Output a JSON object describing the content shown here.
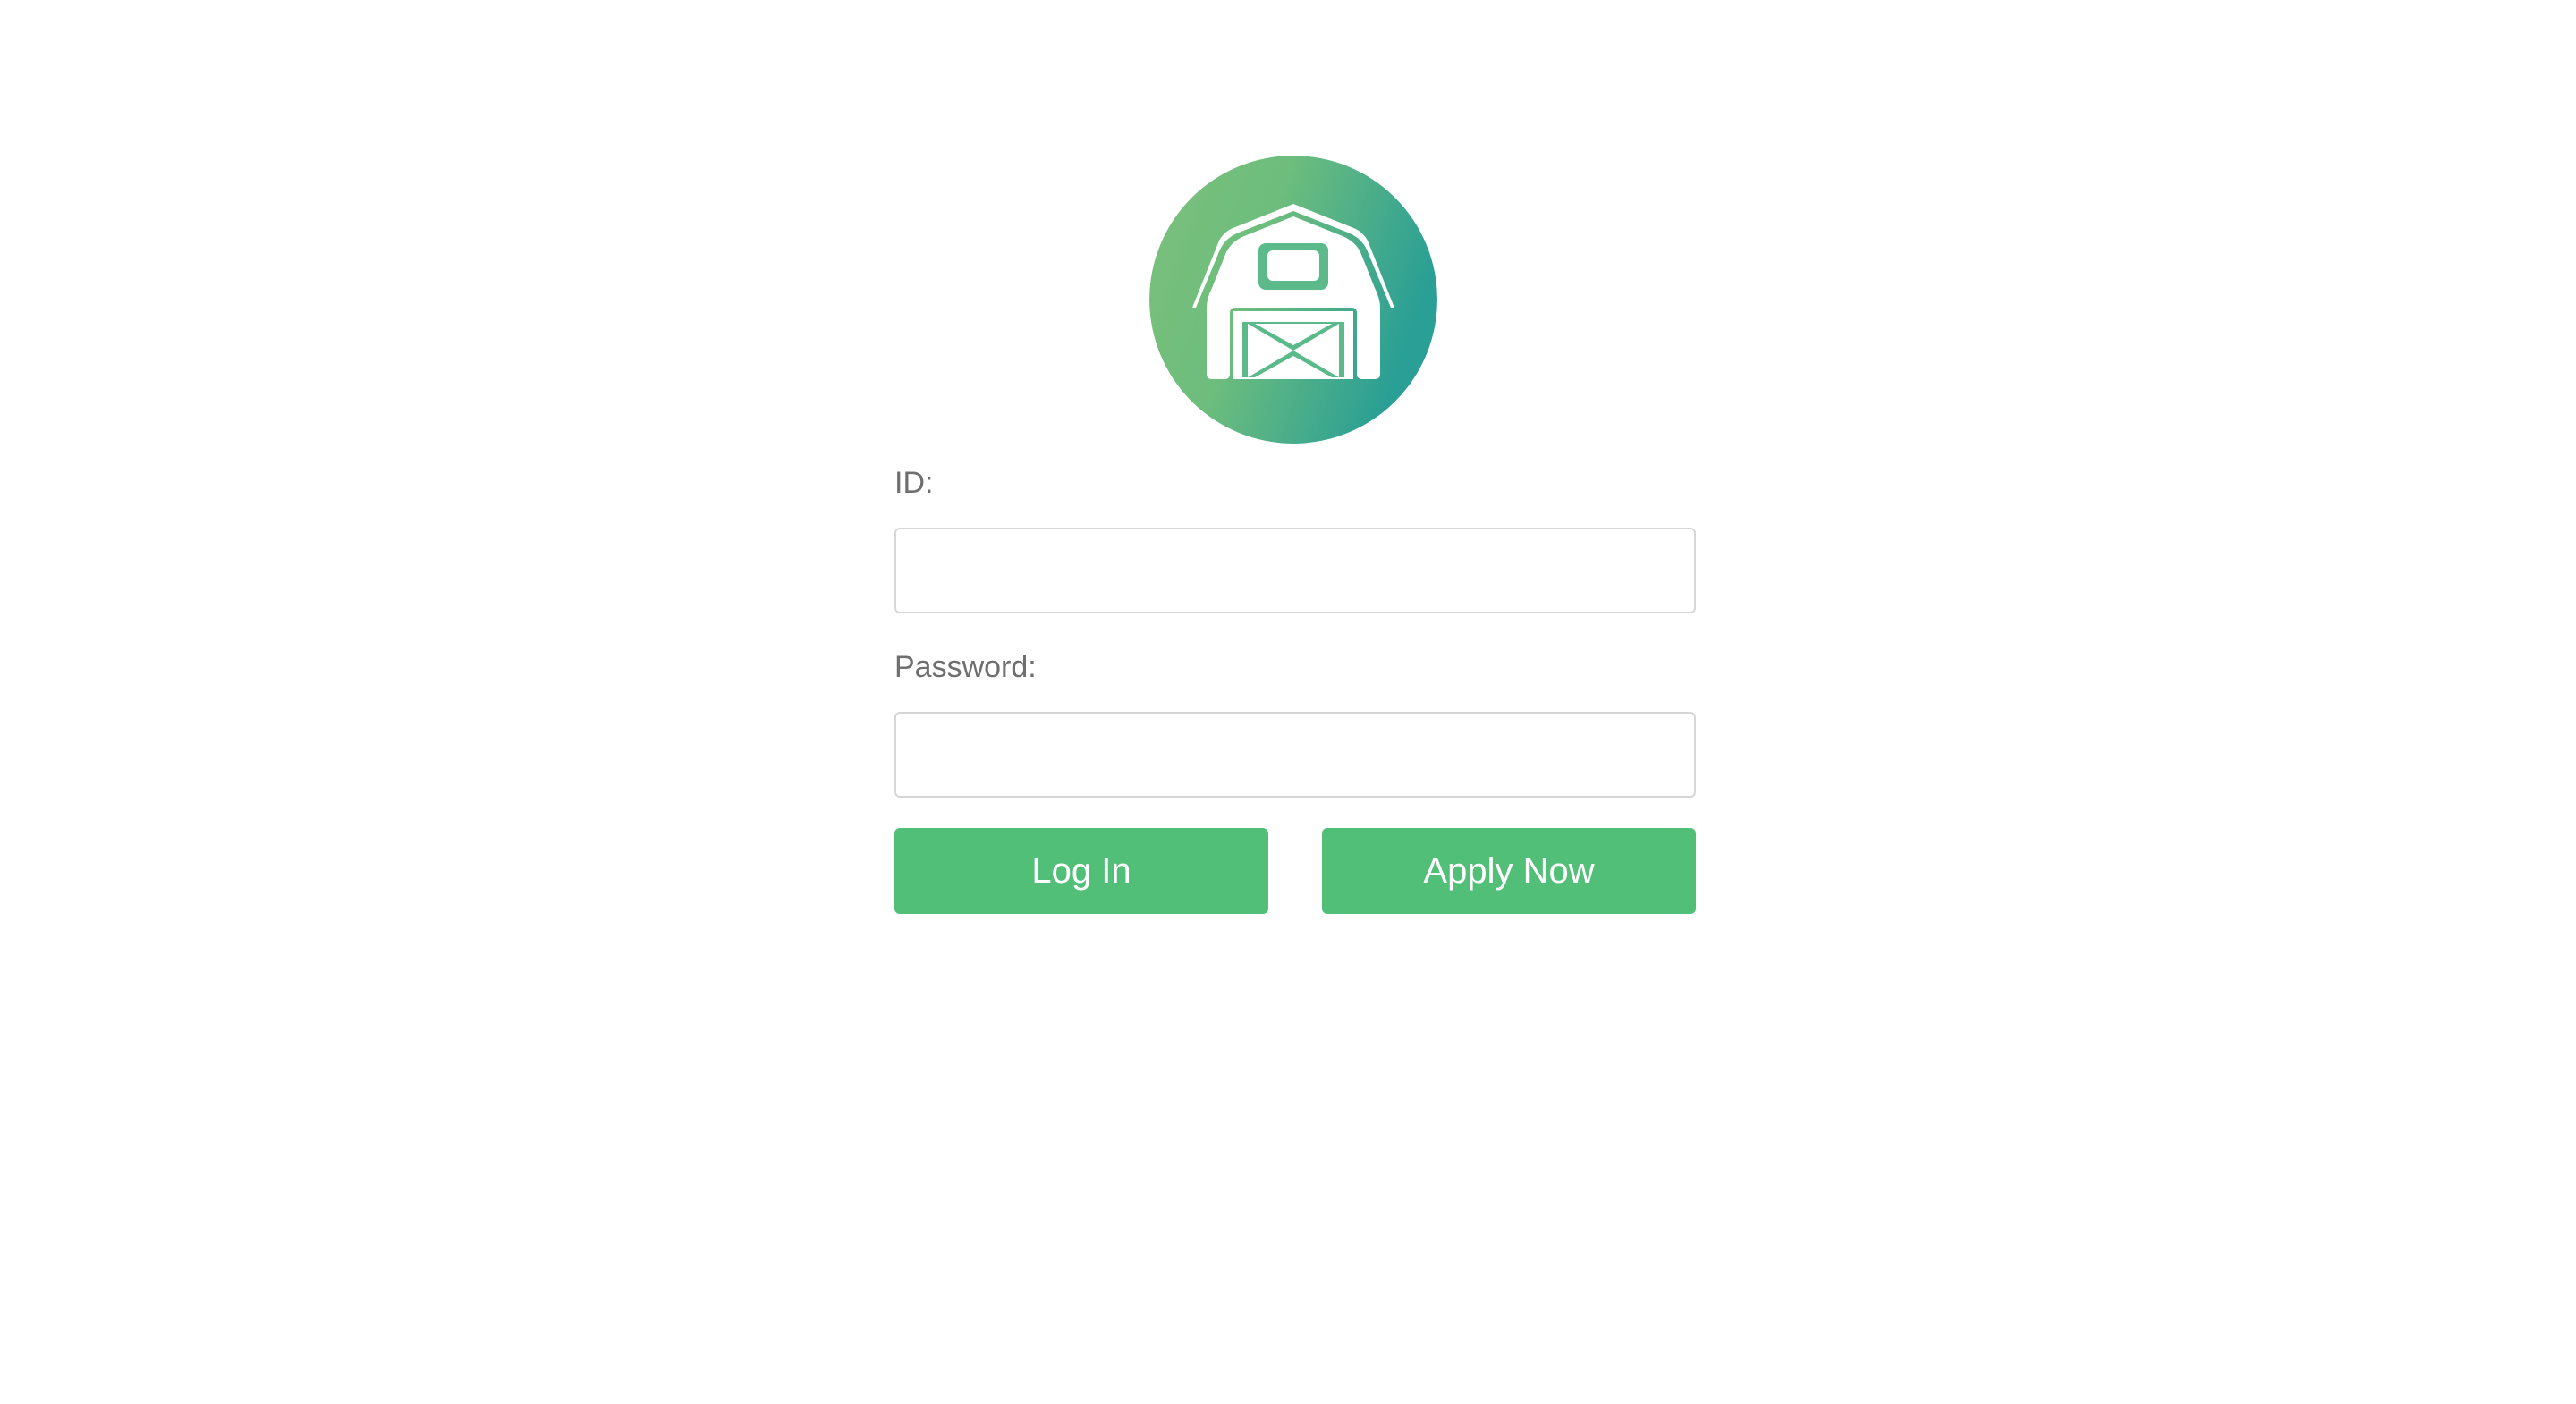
{
  "logo": {
    "icon": "barn-icon",
    "gradient_start": "#7cc07b",
    "gradient_end": "#2fa393"
  },
  "form": {
    "id_label": "ID:",
    "id_value": "",
    "password_label": "Password:",
    "password_value": ""
  },
  "buttons": {
    "login_label": "Log In",
    "apply_label": "Apply Now",
    "color": "#52bf78"
  }
}
